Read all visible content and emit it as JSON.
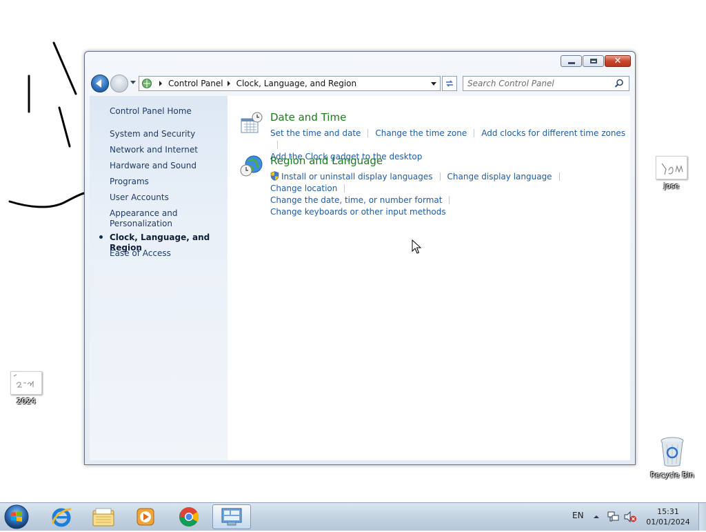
{
  "window": {
    "title": "Clock, Language, and Region",
    "controls": {
      "minimize": "minimize",
      "maximize": "maximize",
      "close": "✕"
    }
  },
  "address_bar": {
    "crumbs": [
      "Control Panel",
      "Clock, Language, and Region"
    ]
  },
  "search": {
    "placeholder": "Search Control Panel",
    "value": ""
  },
  "sidebar": {
    "items": [
      {
        "label": "Control Panel Home"
      },
      {
        "label": "System and Security"
      },
      {
        "label": "Network and Internet"
      },
      {
        "label": "Hardware and Sound"
      },
      {
        "label": "Programs"
      },
      {
        "label": "User Accounts"
      },
      {
        "label": "Appearance and Personalization"
      },
      {
        "label": "Clock, Language, and Region",
        "current": true
      },
      {
        "label": "Ease of Access"
      }
    ]
  },
  "categories": [
    {
      "title": "Date and Time",
      "icon": "clock-calendar-icon",
      "tasks": [
        "Set the time and date",
        "Change the time zone",
        "Add clocks for different time zones",
        "Add the Clock gadget to the desktop"
      ]
    },
    {
      "title": "Region and Language",
      "icon": "globe-clock-icon",
      "tasks": [
        "Install or uninstall display languages",
        "Change display language",
        "Change location",
        "Change the date, time, or number format",
        "Change keyboards or other input methods"
      ]
    }
  ],
  "desktop": {
    "icons": [
      {
        "label": "jose"
      },
      {
        "label": "2024"
      },
      {
        "label": "Recycle Bin"
      }
    ]
  },
  "taskbar": {
    "apps": [
      "internet-explorer-icon",
      "windows-explorer-icon",
      "media-player-icon",
      "chrome-icon",
      "control-panel-icon"
    ],
    "language": "EN",
    "time": "15:31",
    "date": "01/01/2024"
  },
  "colors": {
    "link": "#1e5ba8",
    "category_title": "#1d7a1d",
    "sidebar_text": "#1e3a64"
  }
}
